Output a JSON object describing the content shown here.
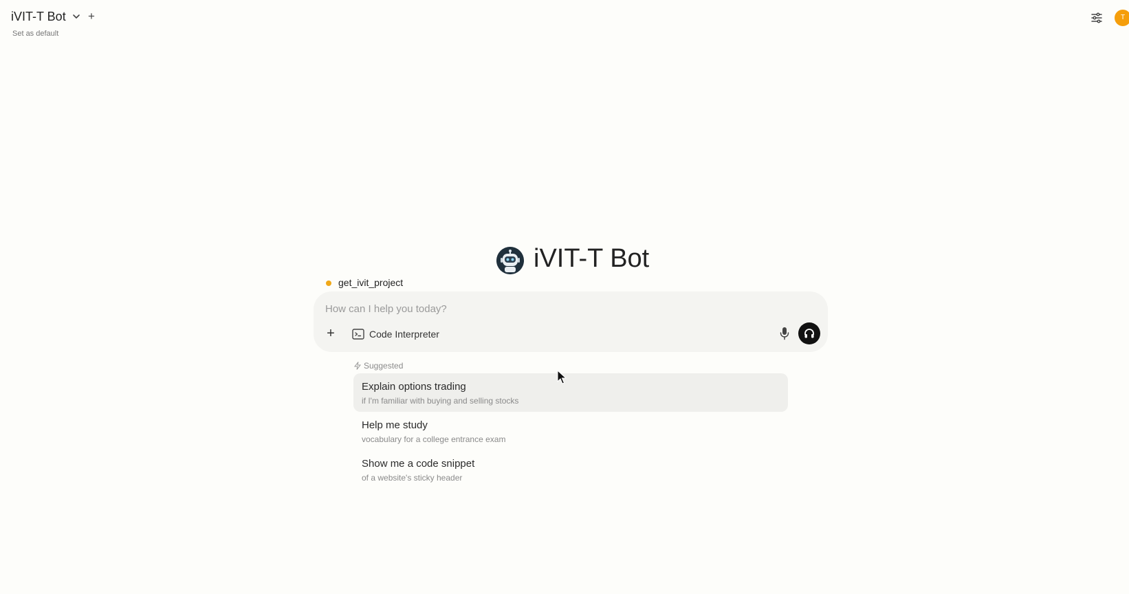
{
  "header": {
    "model_name": "iVIT-T Bot",
    "set_default_label": "Set as default",
    "user_initial": "T",
    "avatar_color": "#f59e0b"
  },
  "hero": {
    "title": "iVIT-T Bot"
  },
  "tool": {
    "name": "get_ivit_project",
    "status_color": "#f0a818"
  },
  "composer": {
    "placeholder": "How can I help you today?",
    "value": "",
    "code_interpreter_label": "Code Interpreter"
  },
  "suggestions": {
    "heading": "Suggested",
    "items": [
      {
        "title": "Explain options trading",
        "subtitle": "if I'm familiar with buying and selling stocks"
      },
      {
        "title": "Help me study",
        "subtitle": "vocabulary for a college entrance exam"
      },
      {
        "title": "Show me a code snippet",
        "subtitle": "of a website's sticky header"
      }
    ]
  }
}
